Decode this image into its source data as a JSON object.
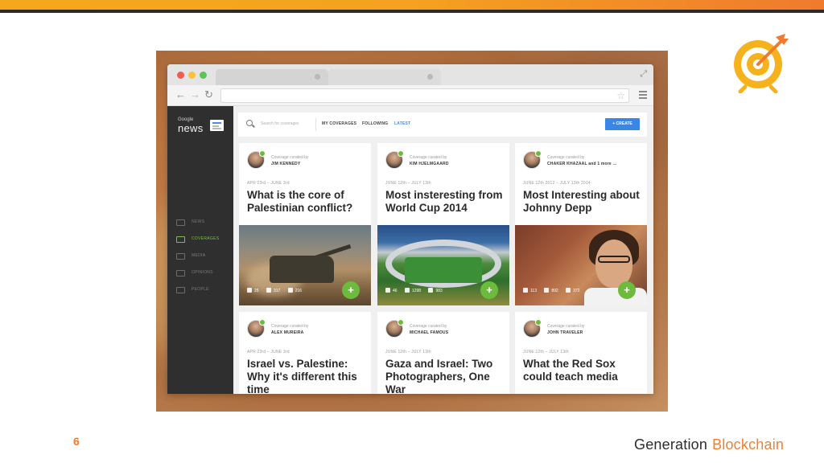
{
  "browser": {
    "toolbar": {
      "star": "☆"
    }
  },
  "app": {
    "logo_google": "Google",
    "logo_news": "news",
    "nav": [
      {
        "label": "NEWS"
      },
      {
        "label": "COVERAGES"
      },
      {
        "label": "MEDIA"
      },
      {
        "label": "OPINIONS"
      },
      {
        "label": "PEOPLE"
      }
    ],
    "search_placeholder": "Search for coverages",
    "tabs": {
      "my_coverages": "MY COVERAGES",
      "following": "FOLLOWING",
      "latest": "LATEST"
    },
    "create_label": "+ CREATE"
  },
  "cards": [
    {
      "curated_label": "Coverage curated by",
      "curator": "JIM KENNEDY",
      "dates": "APR 23rd – JUNE 3rd",
      "headline": "What is the core of Palestinian conflict?",
      "stats": [
        "25",
        "317",
        "216"
      ]
    },
    {
      "curated_label": "Coverage curated by",
      "curator": "KIM HJELMGAARD",
      "dates": "JUNE 12th – JULY 13th",
      "headline": "Most insteresting from World Cup 2014",
      "stats": [
        "46",
        "1298",
        "983"
      ]
    },
    {
      "curated_label": "Coverage curated by",
      "curator": "CHAKER KHAZAAL and 1 more ...",
      "dates": "JUNE 12th 2012 – JULY 13th 2014",
      "headline": "Most Interesting about Johnny Depp",
      "stats": [
        "113",
        "892",
        "372"
      ]
    },
    {
      "curated_label": "Coverage curated by",
      "curator": "ALEX MUREIRA",
      "dates": "APR 23rd – JUNE 3rd",
      "headline": "Israel vs. Palestine: Why it's different this time"
    },
    {
      "curated_label": "Coverage curated by",
      "curator": "MICHAEL FAMOUS",
      "dates": "JUNE 12th – JULY 13th",
      "headline": "Gaza and Israel: Two Photographers, One War"
    },
    {
      "curated_label": "Coverage curated by",
      "curator": "JOHN TRAVELER",
      "dates": "JUNE 12th – JULY 13th",
      "headline": "What the Red Sox could teach media"
    }
  ],
  "slide": {
    "number": "6",
    "brand_part1": "Generation",
    "brand_part2": "Blockchain"
  },
  "colors": {
    "accent_orange": "#f07a2e",
    "accent_yellow": "#f6a81d",
    "green": "#6dbb3d",
    "blue": "#3a86e6"
  }
}
